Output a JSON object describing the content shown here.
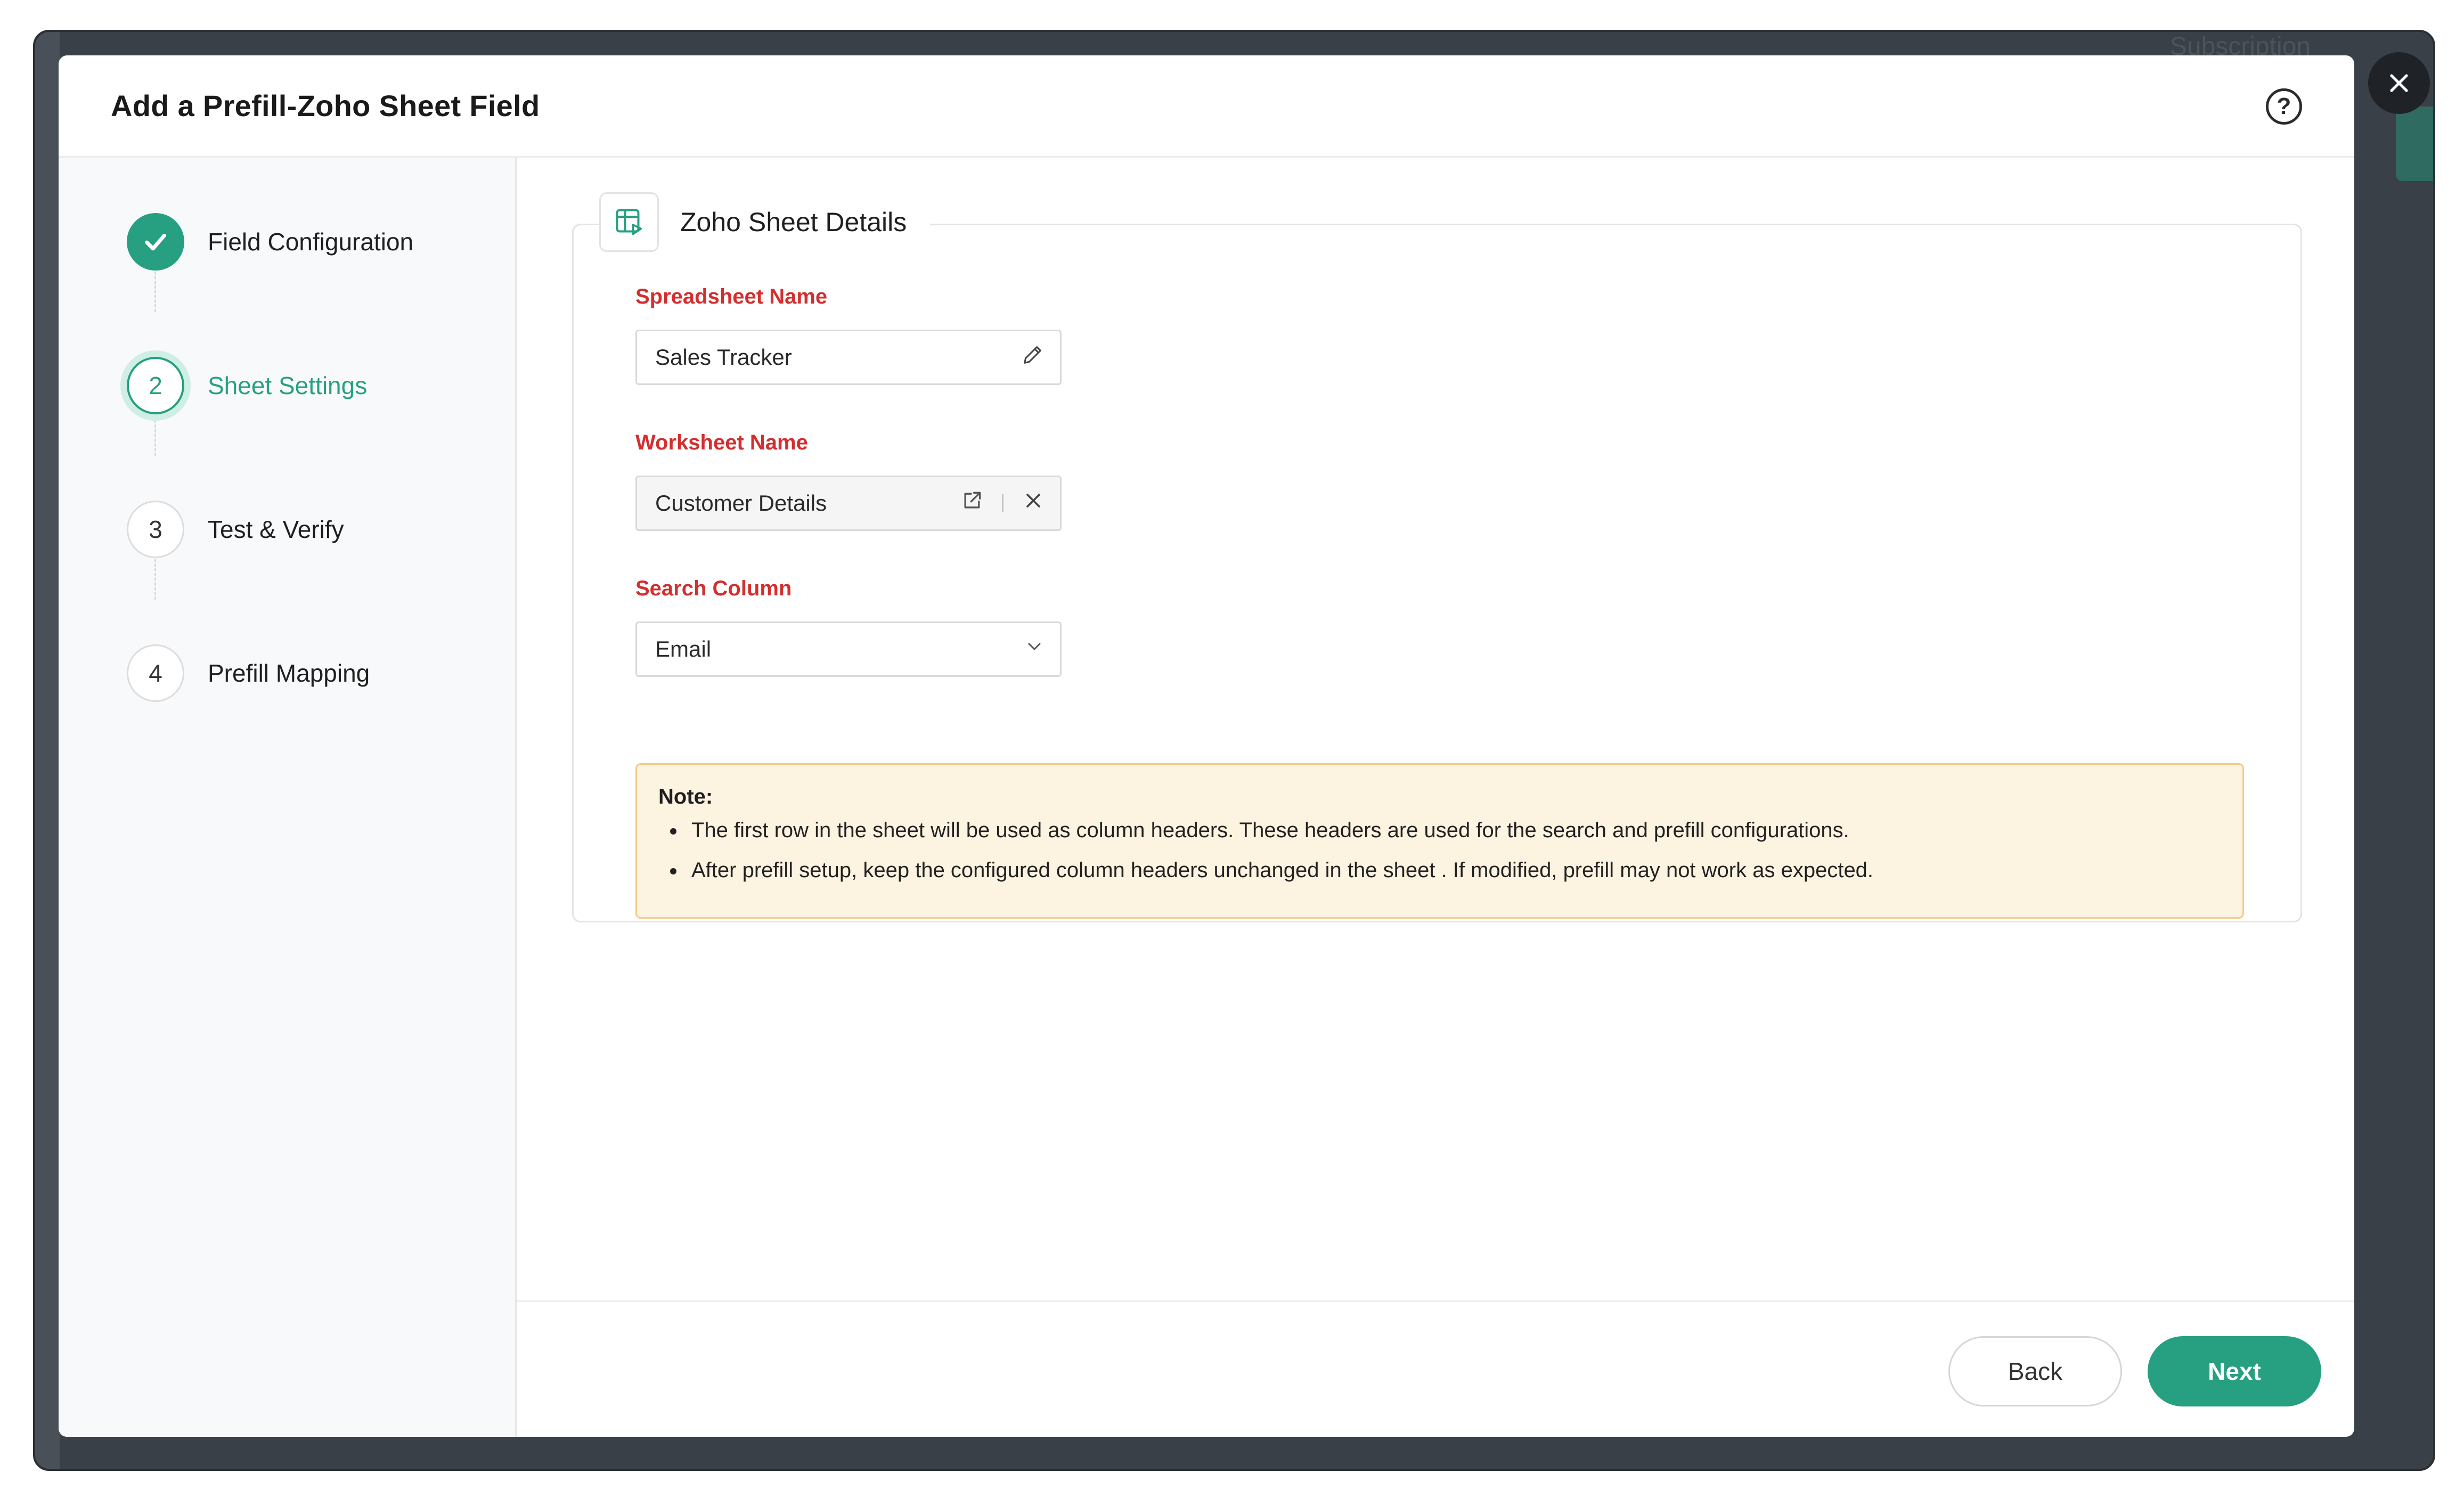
{
  "background": {
    "subscription_text": "Subscription"
  },
  "dialog": {
    "title": "Add a Prefill-Zoho Sheet Field",
    "help_symbol": "?"
  },
  "steps": [
    {
      "number": "1",
      "label": "Field Configuration",
      "state": "completed"
    },
    {
      "number": "2",
      "label": "Sheet Settings",
      "state": "active"
    },
    {
      "number": "3",
      "label": "Test & Verify",
      "state": "pending"
    },
    {
      "number": "4",
      "label": "Prefill Mapping",
      "state": "pending"
    }
  ],
  "section": {
    "title": "Zoho Sheet Details",
    "icon": "spreadsheet-icon"
  },
  "fields": {
    "spreadsheet": {
      "label": "Spreadsheet Name",
      "value": "Sales Tracker",
      "icon": "pencil-icon"
    },
    "worksheet": {
      "label": "Worksheet Name",
      "value": "Customer Details",
      "icons": [
        "external-link-icon",
        "clear-icon"
      ]
    },
    "search_column": {
      "label": "Search Column",
      "value": "Email",
      "icon": "chevron-down-icon"
    }
  },
  "note": {
    "title": "Note:",
    "items": [
      "The first row in the sheet will be used as column headers. These headers are used for the search and prefill configurations.",
      "After prefill setup, keep the configured column headers unchanged in the sheet . If modified, prefill may not work as expected."
    ]
  },
  "footer": {
    "back_label": "Back",
    "next_label": "Next"
  },
  "colors": {
    "accent": "#26a081",
    "required_label": "#d32f2f",
    "note_bg": "#fdf3e1",
    "note_border": "#f1cc86"
  }
}
